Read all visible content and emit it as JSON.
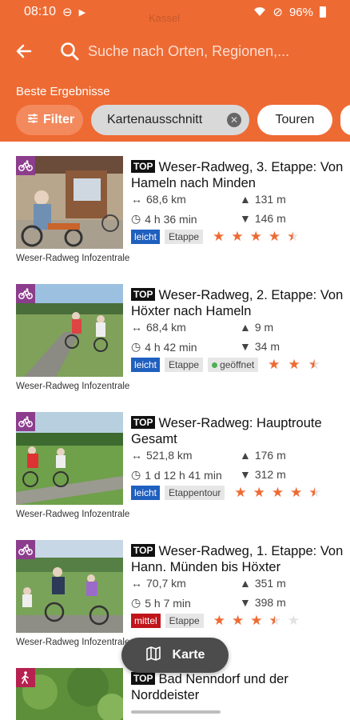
{
  "status_bar": {
    "time": "08:10",
    "battery": "96%"
  },
  "map_ghost": "Kassel",
  "search": {
    "placeholder": "Suche nach Orten, Regionen,..."
  },
  "section_label": "Beste Ergebnisse",
  "chips": {
    "filter": "Filter",
    "map_section": "Kartenausschnitt",
    "tours": "Touren"
  },
  "items": [
    {
      "badge": "TOP",
      "title": "Weser-Radweg, 3. Etappe: Von Hameln nach Minden",
      "category_icon": "bike-icon",
      "distance": "68,6 km",
      "ascent": "131 m",
      "duration": "4 h 36 min",
      "descent": "146 m",
      "difficulty": "leicht",
      "type": "Etappe",
      "status": "",
      "rating": 4.5,
      "source": "Weser-Radweg Infozentrale"
    },
    {
      "badge": "TOP",
      "title": "Weser-Radweg, 2. Etappe: Von Höxter nach Hameln",
      "category_icon": "bike-icon",
      "distance": "68,4 km",
      "ascent": "9 m",
      "duration": "4 h 42 min",
      "descent": "34 m",
      "difficulty": "leicht",
      "type": "Etappe",
      "status": "geöffnet",
      "rating": 2.5,
      "source": "Weser-Radweg Infozentrale"
    },
    {
      "badge": "TOP",
      "title": "Weser-Radweg: Hauptroute Gesamt",
      "category_icon": "bike-icon",
      "distance": "521,8 km",
      "ascent": "176 m",
      "duration": "1 d 12 h 41 min",
      "descent": "312 m",
      "difficulty": "leicht",
      "type": "Etappentour",
      "status": "",
      "rating": 4.5,
      "source": "Weser-Radweg Infozentrale"
    },
    {
      "badge": "TOP",
      "title": "Weser-Radweg, 1. Etappe: Von Hann. Münden bis Höxter",
      "category_icon": "bike-icon",
      "distance": "70,7 km",
      "ascent": "351 m",
      "duration": "5 h 7 min",
      "descent": "398 m",
      "difficulty": "mittel",
      "type": "Etappe",
      "status": "",
      "rating": 3.5,
      "source": "Weser-Radweg Infozentrale"
    },
    {
      "badge": "TOP",
      "title": "Bad Nenndorf und der Norddeister",
      "category_icon": "hiking-icon"
    }
  ],
  "fab": {
    "label": "Karte"
  },
  "colors": {
    "accent": "#ee6a33",
    "easy": "#1f5fbf",
    "medium": "#c0151a"
  }
}
